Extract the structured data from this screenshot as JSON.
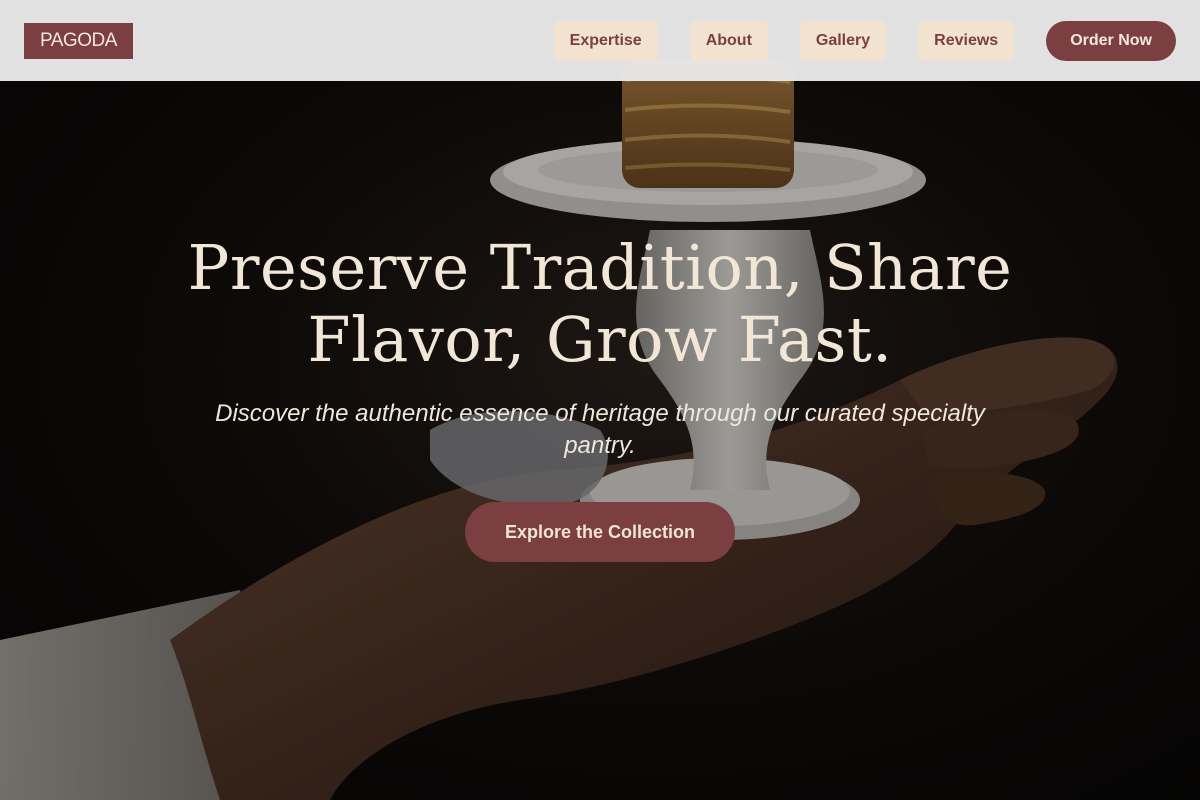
{
  "nav": {
    "logo": "PAGODA",
    "links": [
      {
        "label": "Expertise"
      },
      {
        "label": "About"
      },
      {
        "label": "Gallery"
      },
      {
        "label": "Reviews"
      }
    ],
    "order_button": "Order Now"
  },
  "hero": {
    "headline": "Preserve Tradition, Share Flavor, Grow Fast.",
    "subheadline": "Discover the authentic essence of heritage through our curated specialty pantry.",
    "cta_label": "Explore the Collection"
  },
  "colors": {
    "brand": "#7b3f42",
    "nav_pill_bg": "#f1e3cf",
    "cream_text": "#f2e6d6"
  }
}
